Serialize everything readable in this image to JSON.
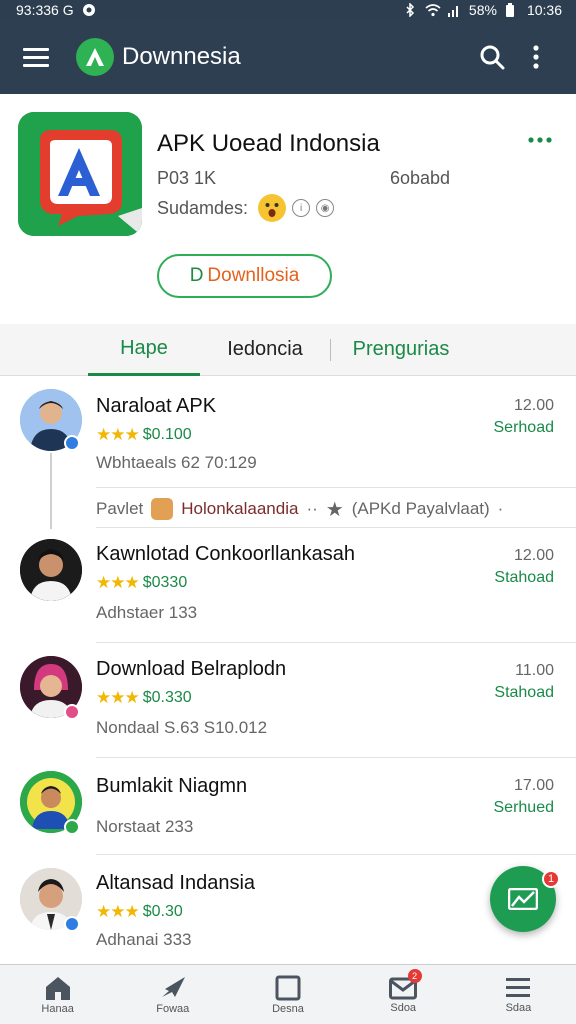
{
  "status_bar": {
    "left_text": "93:336 G",
    "battery": "58%",
    "time": "10:36"
  },
  "app_bar": {
    "title": "Downnesia"
  },
  "app": {
    "name": "APK Uoead Indonsia",
    "size": "P03 1K",
    "developer": "6obabd",
    "subtitle": "Sudamdes:",
    "download_prefix": "D",
    "download_label": "Downllosia"
  },
  "tabs": [
    {
      "label": "Hape",
      "active": true
    },
    {
      "label": "Iedoncia",
      "active": false
    },
    {
      "label": "Prengurias",
      "active": false
    }
  ],
  "items": [
    {
      "title": "Naraloat APK",
      "rating_value": "$0.100",
      "meta": "Wbhtaeals 62 70:129",
      "time": "12.00",
      "action": "Serhoad",
      "avatar_color": "#5b8fd6",
      "badge_color": "#2f7de1"
    },
    {
      "title": "Kawnlotad Conkoorllankasah",
      "rating_value": "$0330",
      "meta": "Adhstaer 133",
      "time": "12.00",
      "action": "Stahoad",
      "avatar_color": "#2a2a2a",
      "badge_color": "#2f7de1"
    },
    {
      "title": "Download Belraplodn",
      "rating_value": "$0.330",
      "meta": "Nondaal S.63 S10.012",
      "time": "11.00",
      "action": "Stahoad",
      "avatar_color": "#8a2a6d",
      "badge_color": "#e24e8a"
    },
    {
      "title": "Bumlakit Niagmn",
      "rating_value": "",
      "meta": "Norstaat 233",
      "time": "17.00",
      "action": "Serhued",
      "avatar_color": "#2ca84a",
      "badge_color": "#2ca84a"
    },
    {
      "title": "Altansad Indansia",
      "rating_value": "$0.30",
      "meta": "Adhanai 333",
      "time": "",
      "action": "",
      "avatar_color": "#d2c7c0",
      "badge_color": "#2f7de1"
    }
  ],
  "sub_row": {
    "prefix": "Pavlet",
    "highlight": "Holonkalaandia",
    "suffix": "(APKd Payalvlaat)"
  },
  "fab": {
    "badge": "1"
  },
  "bottom_nav": [
    {
      "label": "Hanaa",
      "icon": "home-icon"
    },
    {
      "label": "Fowaa",
      "icon": "rocket-icon"
    },
    {
      "label": "Desna",
      "icon": "square-icon"
    },
    {
      "label": "Sdoa",
      "icon": "mail-icon",
      "badge": "2"
    },
    {
      "label": "Sdaa",
      "icon": "list-icon"
    }
  ],
  "colors": {
    "app_bar": "#2e3f52",
    "accent_green": "#1a8a48",
    "star": "#f2b705",
    "download_text": "#e4621b"
  }
}
